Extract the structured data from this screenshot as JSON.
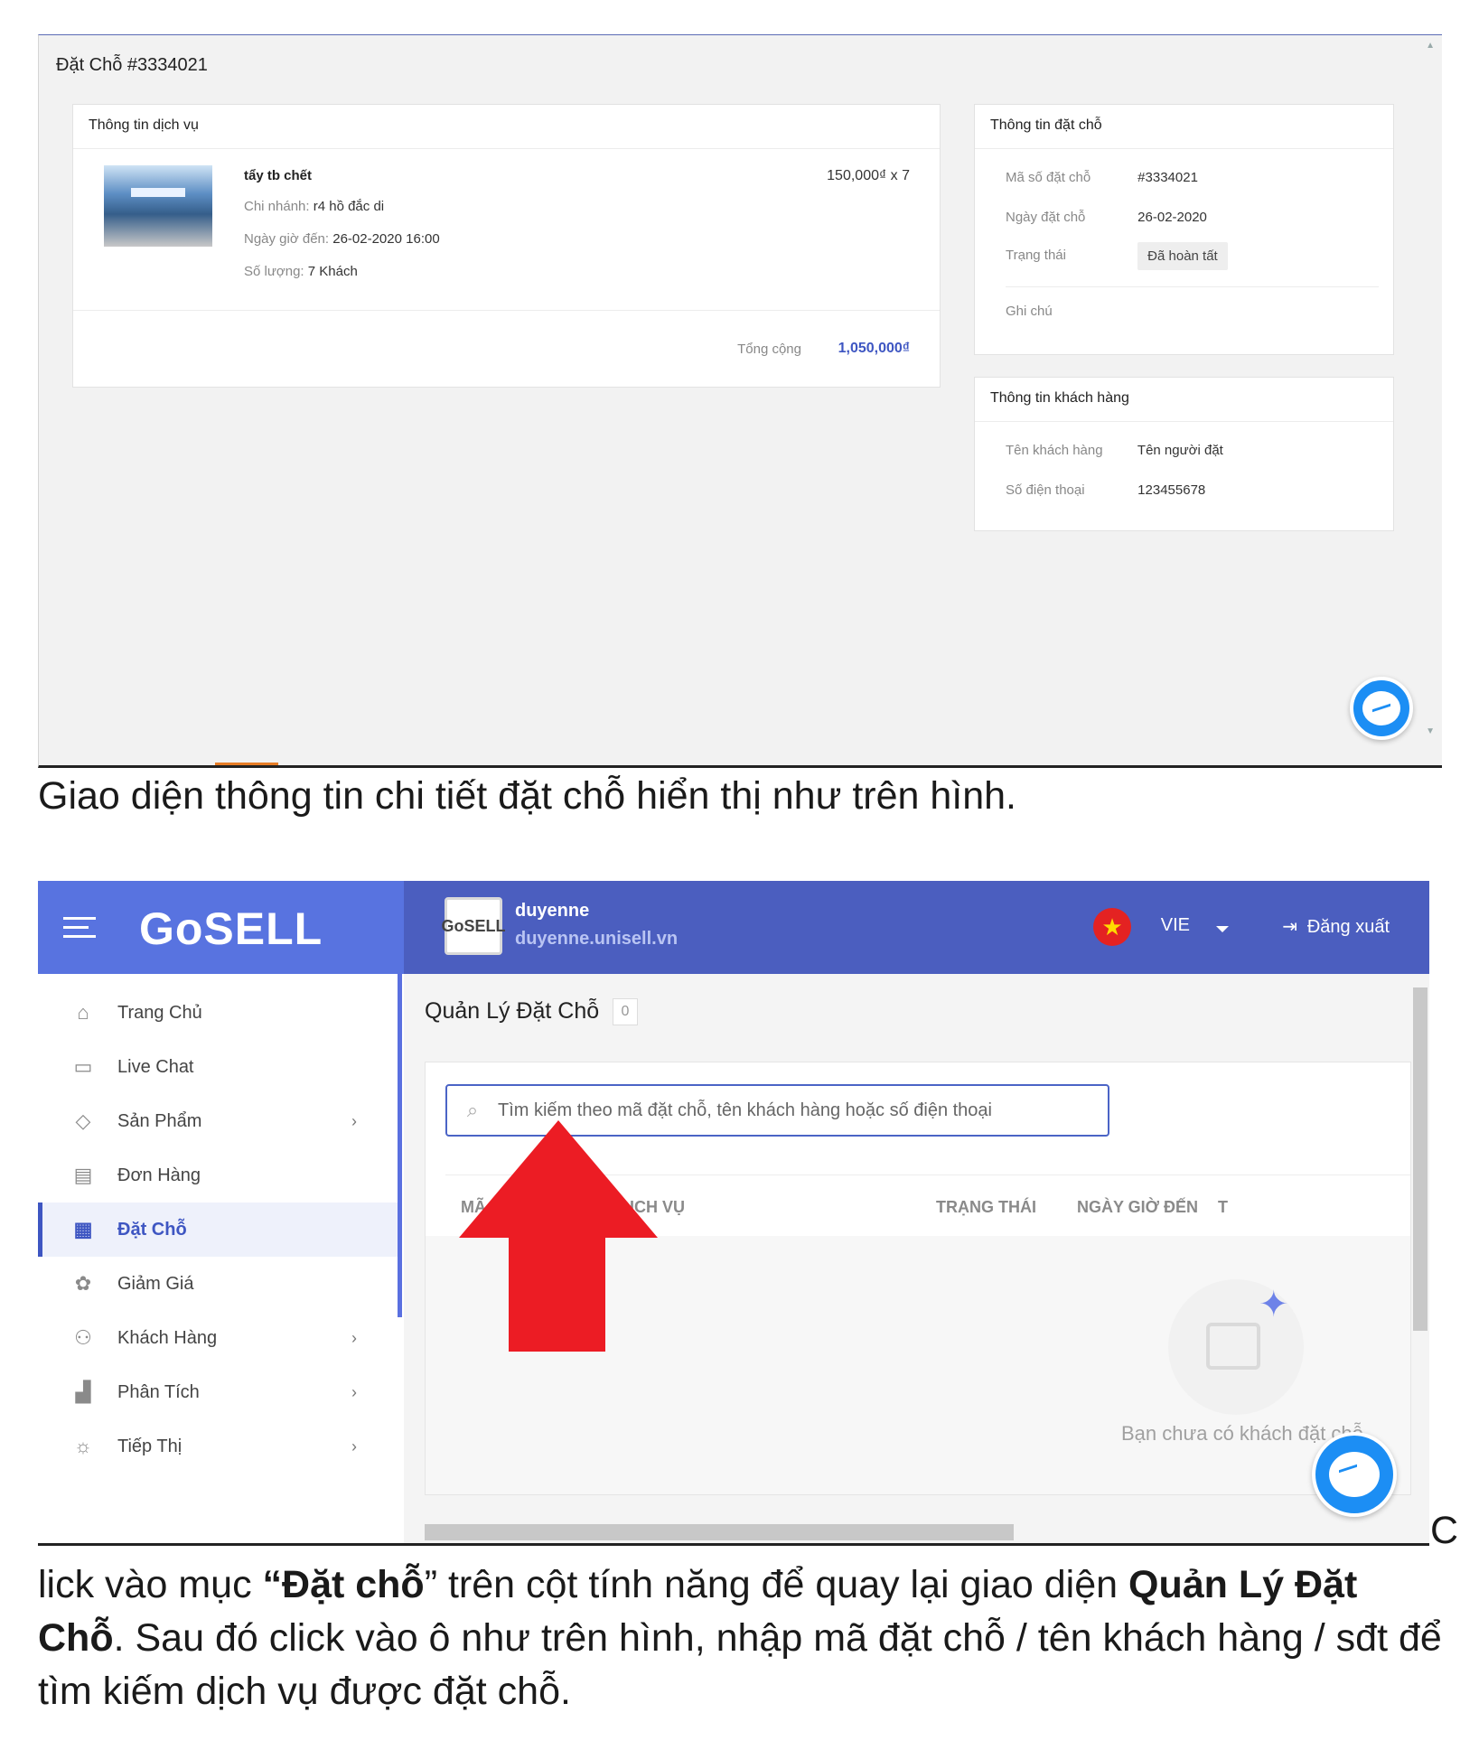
{
  "shot1": {
    "title": "Đặt Chỗ #3334021",
    "service_card": {
      "header": "Thông tin dịch vụ",
      "service_name": "tẩy tb chết",
      "branch_label": "Chi nhánh:",
      "branch_value": "r4 hồ đắc di",
      "arrival_label": "Ngày giờ đến:",
      "arrival_value": "26-02-2020 16:00",
      "qty_label": "Số lượng:",
      "qty_value": "7 Khách",
      "price": "150,000₫ x 7",
      "total_label": "Tổng cộng",
      "total_value": "1,050,000₫"
    },
    "booking_card": {
      "header": "Thông tin đặt chỗ",
      "code_label": "Mã số đặt chỗ",
      "code_value": "#3334021",
      "date_label": "Ngày đặt chỗ",
      "date_value": "26-02-2020",
      "status_label": "Trạng thái",
      "status_value": "Đã hoàn tất",
      "note_label": "Ghi chú"
    },
    "customer_card": {
      "header": "Thông tin khách hàng",
      "name_label": "Tên khách hàng",
      "name_value": "Tên người đặt",
      "phone_label": "Số điện thoại",
      "phone_value": "123455678"
    }
  },
  "caption1": "Giao diện thông tin chi tiết đặt chỗ hiển thị như trên hình.",
  "shot2": {
    "logo": "GoSELL",
    "shop_logo_text": "GoSELL",
    "shop_name": "duyenne",
    "shop_url": "duyenne.unisell.vn",
    "language": "VIE",
    "logout": "Đăng xuất",
    "sidebar": [
      {
        "label": "Trang Chủ",
        "icon": "home-icon",
        "chevron": false
      },
      {
        "label": "Live Chat",
        "icon": "chat-icon",
        "chevron": false
      },
      {
        "label": "Sản Phẩm",
        "icon": "tag-icon",
        "chevron": true
      },
      {
        "label": "Đơn Hàng",
        "icon": "order-icon",
        "chevron": false
      },
      {
        "label": "Đặt Chỗ",
        "icon": "calendar-icon",
        "chevron": false,
        "active": true
      },
      {
        "label": "Giảm Giá",
        "icon": "discount-icon",
        "chevron": false
      },
      {
        "label": "Khách Hàng",
        "icon": "users-icon",
        "chevron": true
      },
      {
        "label": "Phân Tích",
        "icon": "analytics-icon",
        "chevron": true
      },
      {
        "label": "Tiếp Thị",
        "icon": "bulb-icon",
        "chevron": true
      }
    ],
    "page_title": "Quản Lý Đặt Chỗ",
    "count": "0",
    "search_placeholder": "Tìm kiếm theo mã đặt chỗ, tên khách hàng hoặc số điện thoại",
    "columns": [
      "MÃ",
      "TÊN DỊCH VỤ",
      "TRẠNG THÁI",
      "NGÀY GIỜ ĐẾN",
      "T"
    ],
    "empty_text": "Bạn chưa có khách đặt chỗ",
    "accent_color": "#5873e0",
    "arrow_color": "#ec1c24"
  },
  "caption2": {
    "tail": "C",
    "part1": "lick vào mục ",
    "bold1": "“Đặt chỗ",
    "part2": "” trên cột tính năng để quay lại giao diện ",
    "bold2": "Quản Lý Đặt Chỗ",
    "part3": ". Sau đó click vào ô như trên hình, nhập mã đặt chỗ / tên khách hàng / sđt để tìm kiếm dịch vụ được đặt chỗ."
  }
}
